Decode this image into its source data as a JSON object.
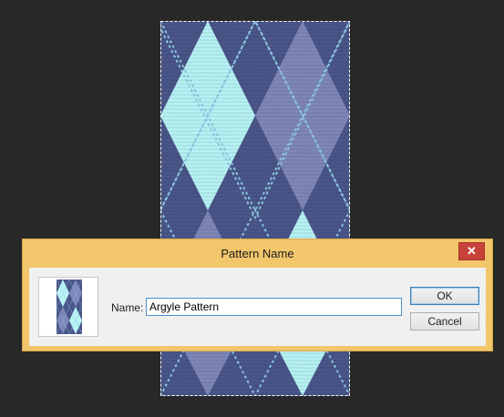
{
  "dialog": {
    "title": "Pattern Name",
    "close_label": "✕",
    "name_label": "Name:",
    "name_value": "Argyle Pattern",
    "ok_label": "OK",
    "cancel_label": "Cancel"
  },
  "pattern": {
    "name": "argyle",
    "colors": {
      "background": "#4a5689",
      "diamond_light": "#b7f2f5",
      "diamond_mid": "#7f87b9",
      "stitch_line": "#8fc8e6"
    }
  },
  "colors": {
    "workspace_bg": "#282828",
    "dialog_frame": "#f2c66b",
    "dialog_body": "#f0f0f0",
    "close_button": "#c7433a",
    "input_border": "#4e8fd1"
  },
  "icons": {
    "close": "close-icon",
    "thumbnail": "pattern-thumbnail"
  }
}
